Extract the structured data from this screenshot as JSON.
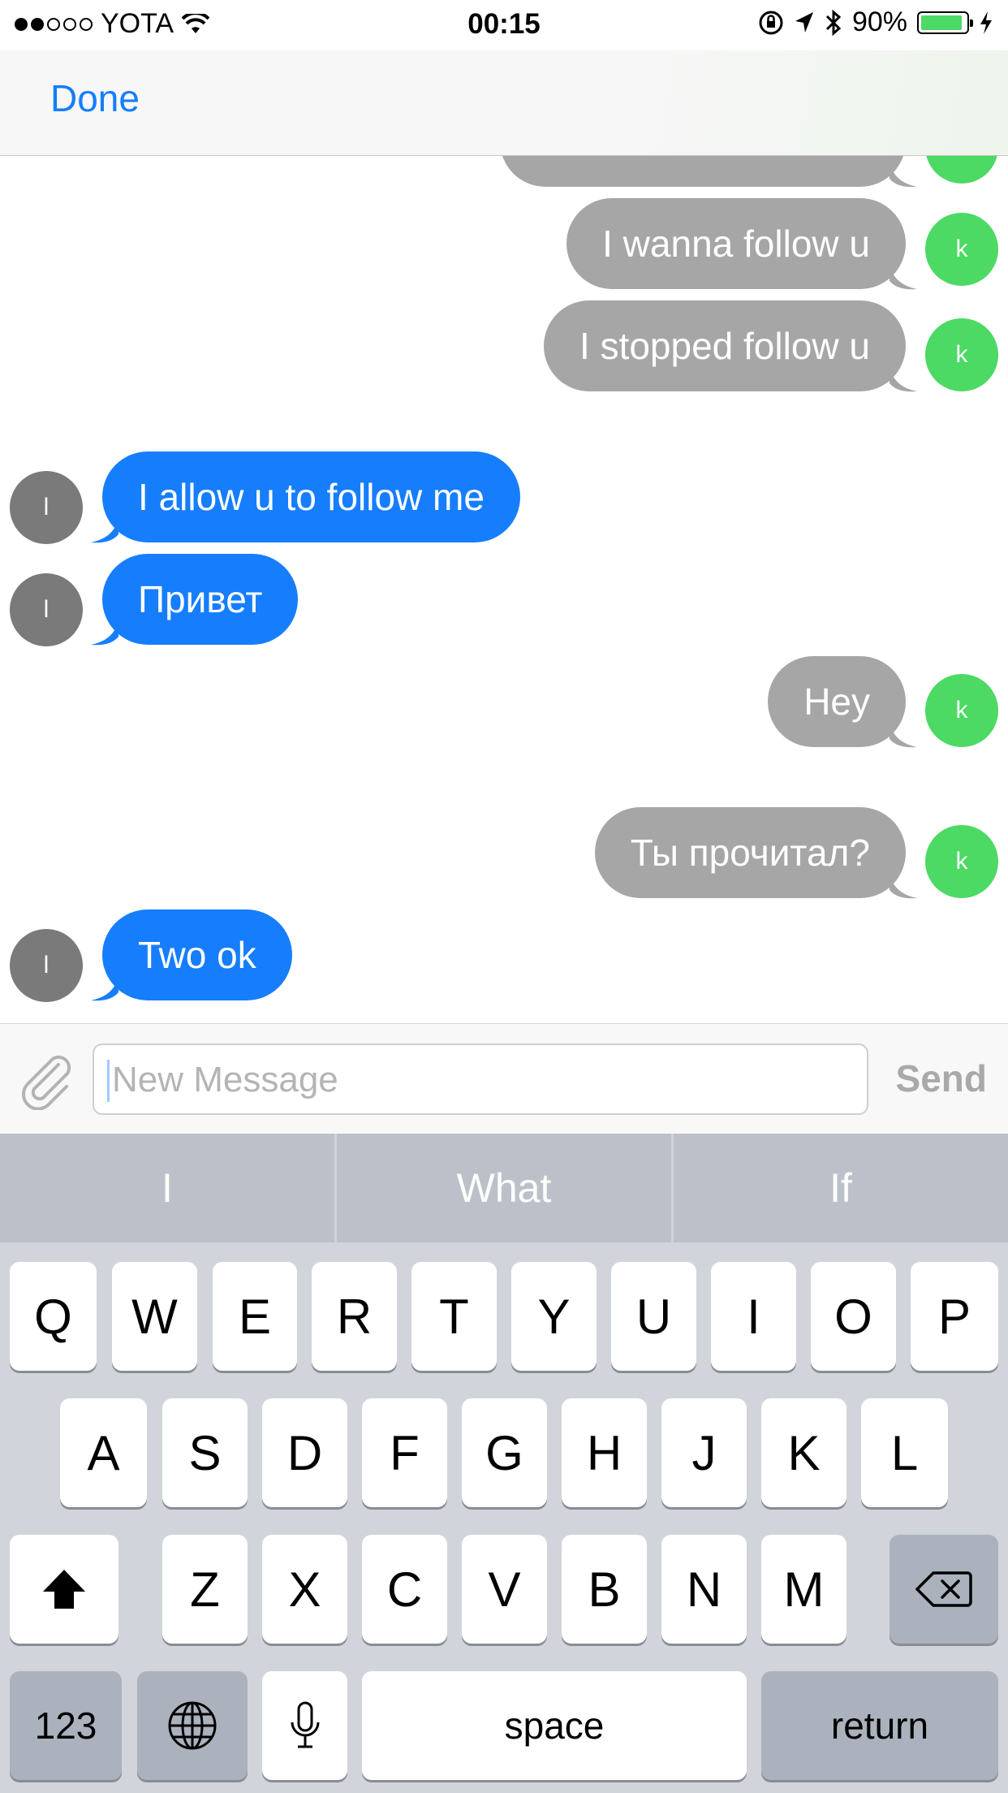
{
  "status_bar": {
    "carrier": "YOTA",
    "time": "00:15",
    "battery_percent": "90%",
    "battery_level": 0.9,
    "signal_bars": 2,
    "icons": [
      "wifi-icon",
      "orientation-lock-icon",
      "location-arrow-icon",
      "bluetooth-icon",
      "battery-icon",
      "charging-bolt-icon"
    ]
  },
  "navbar": {
    "done_label": "Done"
  },
  "messages": [
    {
      "side": "out",
      "avatar": "k",
      "text": "I wanna follow u"
    },
    {
      "side": "out",
      "avatar": "k",
      "text": "I stopped follow u"
    },
    {
      "side": "in",
      "avatar": "l",
      "text": "I allow u to follow me"
    },
    {
      "side": "in",
      "avatar": "l",
      "text": "Привет"
    },
    {
      "side": "out",
      "avatar": "k",
      "text": "Hey"
    },
    {
      "side": "out",
      "avatar": "k",
      "text": "Ты прочитал?"
    },
    {
      "side": "in",
      "avatar": "l",
      "text": "Two ok"
    }
  ],
  "input_bar": {
    "placeholder": "New Message",
    "send_label": "Send",
    "attach_icon": "paperclip-icon"
  },
  "keyboard": {
    "suggestions": [
      "I",
      "What",
      "If"
    ],
    "row1": [
      "Q",
      "W",
      "E",
      "R",
      "T",
      "Y",
      "U",
      "I",
      "O",
      "P"
    ],
    "row2": [
      "A",
      "S",
      "D",
      "F",
      "G",
      "H",
      "J",
      "K",
      "L"
    ],
    "row3": [
      "Z",
      "X",
      "C",
      "V",
      "B",
      "N",
      "M"
    ],
    "numbers_label": "123",
    "space_label": "space",
    "return_label": "return",
    "icons": [
      "shift-icon",
      "backspace-icon",
      "globe-icon",
      "microphone-icon"
    ]
  },
  "colors": {
    "accent": "#157efb",
    "incoming_bubble": "#167efc",
    "outgoing_bubble": "#a6a6a6",
    "outgoing_avatar": "#4cd964",
    "incoming_avatar": "#7a7a7a"
  }
}
